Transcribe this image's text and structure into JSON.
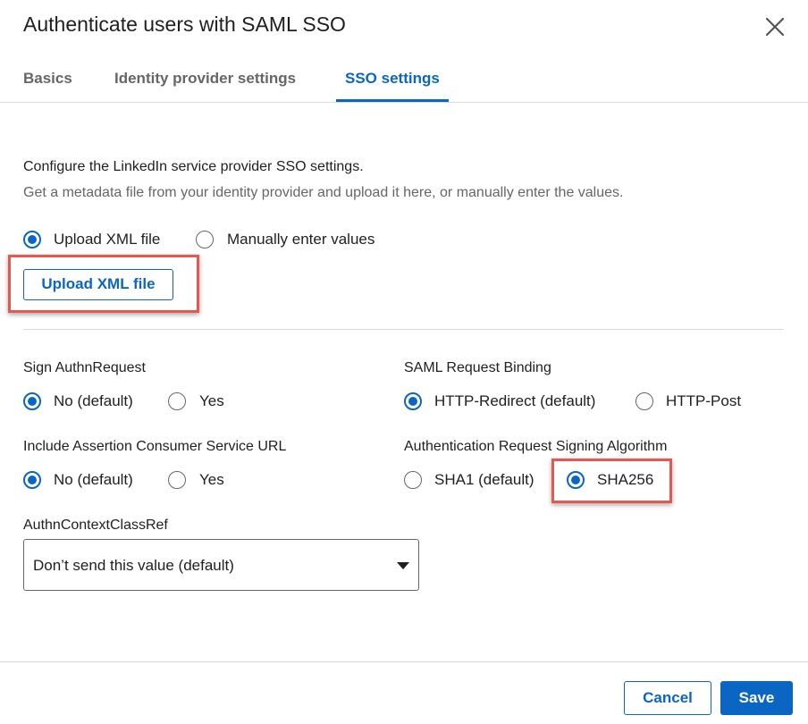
{
  "dialog": {
    "title": "Authenticate users with SAML SSO",
    "close_icon": "close-icon"
  },
  "tabs": [
    {
      "label": "Basics",
      "active": false
    },
    {
      "label": "Identity provider settings",
      "active": false
    },
    {
      "label": "SSO settings",
      "active": true
    }
  ],
  "intro": {
    "heading": "Configure the LinkedIn service provider SSO settings.",
    "description": "Get a metadata file from your identity provider and upload it here, or manually enter the values."
  },
  "source_options": {
    "upload_label": "Upload XML file",
    "manual_label": "Manually enter values",
    "selected": "upload"
  },
  "upload_button_label": "Upload XML file",
  "sign_authn": {
    "label": "Sign AuthnRequest",
    "options": [
      "No (default)",
      "Yes"
    ],
    "selected": "No (default)"
  },
  "request_binding": {
    "label": "SAML Request Binding",
    "options": [
      "HTTP-Redirect (default)",
      "HTTP-Post"
    ],
    "selected": "HTTP-Redirect (default)"
  },
  "include_acs": {
    "label": "Include Assertion Consumer Service URL",
    "options": [
      "No (default)",
      "Yes"
    ],
    "selected": "No (default)"
  },
  "signing_algorithm": {
    "label": "Authentication Request Signing Algorithm",
    "options": [
      "SHA1 (default)",
      "SHA256"
    ],
    "selected": "SHA256"
  },
  "authn_context": {
    "label": "AuthnContextClassRef",
    "value": "Don’t send this value (default)"
  },
  "footer": {
    "cancel_label": "Cancel",
    "save_label": "Save"
  },
  "colors": {
    "accent": "#0a66c2",
    "highlight": "#e8574f"
  }
}
